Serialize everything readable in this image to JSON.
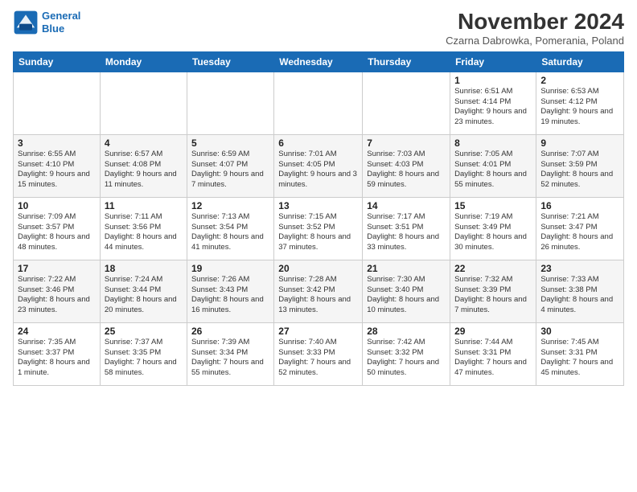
{
  "header": {
    "logo_line1": "General",
    "logo_line2": "Blue",
    "month_title": "November 2024",
    "location": "Czarna Dabrowka, Pomerania, Poland"
  },
  "weekdays": [
    "Sunday",
    "Monday",
    "Tuesday",
    "Wednesday",
    "Thursday",
    "Friday",
    "Saturday"
  ],
  "weeks": [
    [
      {
        "day": "",
        "info": ""
      },
      {
        "day": "",
        "info": ""
      },
      {
        "day": "",
        "info": ""
      },
      {
        "day": "",
        "info": ""
      },
      {
        "day": "",
        "info": ""
      },
      {
        "day": "1",
        "info": "Sunrise: 6:51 AM\nSunset: 4:14 PM\nDaylight: 9 hours and 23 minutes."
      },
      {
        "day": "2",
        "info": "Sunrise: 6:53 AM\nSunset: 4:12 PM\nDaylight: 9 hours and 19 minutes."
      }
    ],
    [
      {
        "day": "3",
        "info": "Sunrise: 6:55 AM\nSunset: 4:10 PM\nDaylight: 9 hours and 15 minutes."
      },
      {
        "day": "4",
        "info": "Sunrise: 6:57 AM\nSunset: 4:08 PM\nDaylight: 9 hours and 11 minutes."
      },
      {
        "day": "5",
        "info": "Sunrise: 6:59 AM\nSunset: 4:07 PM\nDaylight: 9 hours and 7 minutes."
      },
      {
        "day": "6",
        "info": "Sunrise: 7:01 AM\nSunset: 4:05 PM\nDaylight: 9 hours and 3 minutes."
      },
      {
        "day": "7",
        "info": "Sunrise: 7:03 AM\nSunset: 4:03 PM\nDaylight: 8 hours and 59 minutes."
      },
      {
        "day": "8",
        "info": "Sunrise: 7:05 AM\nSunset: 4:01 PM\nDaylight: 8 hours and 55 minutes."
      },
      {
        "day": "9",
        "info": "Sunrise: 7:07 AM\nSunset: 3:59 PM\nDaylight: 8 hours and 52 minutes."
      }
    ],
    [
      {
        "day": "10",
        "info": "Sunrise: 7:09 AM\nSunset: 3:57 PM\nDaylight: 8 hours and 48 minutes."
      },
      {
        "day": "11",
        "info": "Sunrise: 7:11 AM\nSunset: 3:56 PM\nDaylight: 8 hours and 44 minutes."
      },
      {
        "day": "12",
        "info": "Sunrise: 7:13 AM\nSunset: 3:54 PM\nDaylight: 8 hours and 41 minutes."
      },
      {
        "day": "13",
        "info": "Sunrise: 7:15 AM\nSunset: 3:52 PM\nDaylight: 8 hours and 37 minutes."
      },
      {
        "day": "14",
        "info": "Sunrise: 7:17 AM\nSunset: 3:51 PM\nDaylight: 8 hours and 33 minutes."
      },
      {
        "day": "15",
        "info": "Sunrise: 7:19 AM\nSunset: 3:49 PM\nDaylight: 8 hours and 30 minutes."
      },
      {
        "day": "16",
        "info": "Sunrise: 7:21 AM\nSunset: 3:47 PM\nDaylight: 8 hours and 26 minutes."
      }
    ],
    [
      {
        "day": "17",
        "info": "Sunrise: 7:22 AM\nSunset: 3:46 PM\nDaylight: 8 hours and 23 minutes."
      },
      {
        "day": "18",
        "info": "Sunrise: 7:24 AM\nSunset: 3:44 PM\nDaylight: 8 hours and 20 minutes."
      },
      {
        "day": "19",
        "info": "Sunrise: 7:26 AM\nSunset: 3:43 PM\nDaylight: 8 hours and 16 minutes."
      },
      {
        "day": "20",
        "info": "Sunrise: 7:28 AM\nSunset: 3:42 PM\nDaylight: 8 hours and 13 minutes."
      },
      {
        "day": "21",
        "info": "Sunrise: 7:30 AM\nSunset: 3:40 PM\nDaylight: 8 hours and 10 minutes."
      },
      {
        "day": "22",
        "info": "Sunrise: 7:32 AM\nSunset: 3:39 PM\nDaylight: 8 hours and 7 minutes."
      },
      {
        "day": "23",
        "info": "Sunrise: 7:33 AM\nSunset: 3:38 PM\nDaylight: 8 hours and 4 minutes."
      }
    ],
    [
      {
        "day": "24",
        "info": "Sunrise: 7:35 AM\nSunset: 3:37 PM\nDaylight: 8 hours and 1 minute."
      },
      {
        "day": "25",
        "info": "Sunrise: 7:37 AM\nSunset: 3:35 PM\nDaylight: 7 hours and 58 minutes."
      },
      {
        "day": "26",
        "info": "Sunrise: 7:39 AM\nSunset: 3:34 PM\nDaylight: 7 hours and 55 minutes."
      },
      {
        "day": "27",
        "info": "Sunrise: 7:40 AM\nSunset: 3:33 PM\nDaylight: 7 hours and 52 minutes."
      },
      {
        "day": "28",
        "info": "Sunrise: 7:42 AM\nSunset: 3:32 PM\nDaylight: 7 hours and 50 minutes."
      },
      {
        "day": "29",
        "info": "Sunrise: 7:44 AM\nSunset: 3:31 PM\nDaylight: 7 hours and 47 minutes."
      },
      {
        "day": "30",
        "info": "Sunrise: 7:45 AM\nSunset: 3:31 PM\nDaylight: 7 hours and 45 minutes."
      }
    ]
  ]
}
